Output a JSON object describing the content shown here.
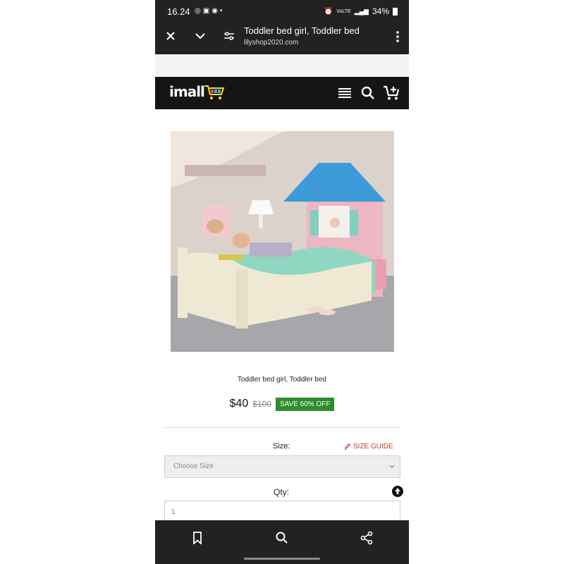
{
  "status_bar": {
    "time": "16.24",
    "left_icons": [
      "instagram-icon",
      "shopping-bag-icon",
      "camera-icon",
      "dot-icon"
    ],
    "signal_text": "VoLTE",
    "battery": "34%"
  },
  "url_bar": {
    "title": "Toddler bed girl, Toddler bed",
    "domain": "lilyshop2020.com"
  },
  "site_header": {
    "logo_text": "imall",
    "icons": [
      "menu-icon",
      "search-icon",
      "cart-icon"
    ]
  },
  "product": {
    "image_alt": "pink and blue toddler cottage bed",
    "name": "Toddler bed girl, Toddler bed",
    "price": "$40",
    "old_price": "$100",
    "save_badge": "SAVE 60% OFF"
  },
  "options": {
    "size_label": "Size:",
    "size_guide": "SIZE GUIDE",
    "size_placeholder": "Choose Size",
    "qty_label": "Qty:",
    "qty_value": "1"
  },
  "bottom_bar": {
    "icons": [
      "bookmark-icon",
      "search-icon",
      "share-icon"
    ]
  },
  "colors": {
    "chrome": "#222222",
    "save_green": "#2d8c2d",
    "size_guide_red": "#c0392b"
  }
}
